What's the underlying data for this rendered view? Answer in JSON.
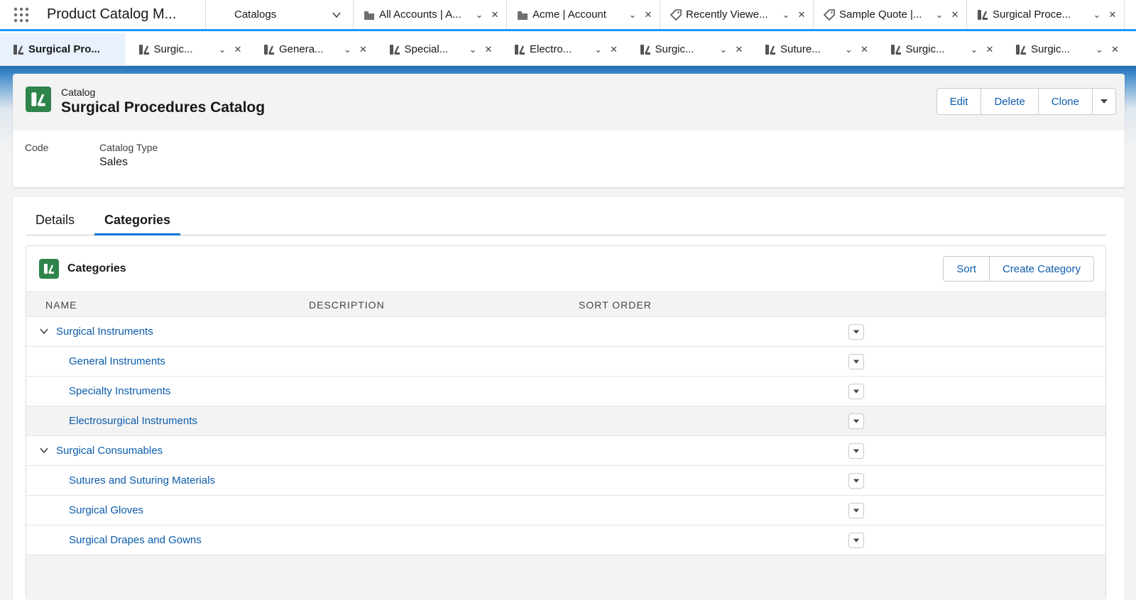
{
  "app": {
    "launcher_icon": "app-launcher-grid-icon",
    "title": "Product Catalog M...",
    "nav_selector": "Catalogs"
  },
  "workspace_tabs": [
    {
      "label": "All Accounts | A...",
      "icon": "account-icon"
    },
    {
      "label": "Acme | Account",
      "icon": "account-icon"
    },
    {
      "label": "Recently Viewe...",
      "icon": "quote-icon"
    },
    {
      "label": "Sample Quote |...",
      "icon": "quote-icon"
    },
    {
      "label": "Surgical Proce...",
      "icon": "catalog-icon",
      "active": true
    }
  ],
  "sub_tabs": [
    {
      "label": "Surgical Pro...",
      "active": true
    },
    {
      "label": "Surgic..."
    },
    {
      "label": "Genera..."
    },
    {
      "label": "Special..."
    },
    {
      "label": "Electro..."
    },
    {
      "label": "Surgic..."
    },
    {
      "label": "Suture..."
    },
    {
      "label": "Surgic..."
    },
    {
      "label": "Surgic..."
    }
  ],
  "record": {
    "object_label": "Catalog",
    "name": "Surgical Procedures Catalog",
    "actions": {
      "edit": "Edit",
      "delete": "Delete",
      "clone": "Clone"
    },
    "fields": {
      "code_label": "Code",
      "catalog_type_label": "Catalog Type",
      "catalog_type_value": "Sales"
    }
  },
  "tabs": {
    "details": "Details",
    "categories": "Categories"
  },
  "related_list": {
    "title": "Categories",
    "sort_label": "Sort",
    "create_label": "Create Category",
    "columns": [
      "NAME",
      "DESCRIPTION",
      "SORT ORDER"
    ],
    "rows": [
      {
        "name": "Surgical Instruments",
        "level": 1,
        "expanded": true
      },
      {
        "name": "General Instruments",
        "level": 2
      },
      {
        "name": "Specialty Instruments",
        "level": 2
      },
      {
        "name": "Electrosurgical Instruments",
        "level": 2,
        "hover": true
      },
      {
        "name": "Surgical Consumables",
        "level": 1,
        "expanded": true
      },
      {
        "name": "Sutures and Suturing Materials",
        "level": 2
      },
      {
        "name": "Surgical Gloves",
        "level": 2
      },
      {
        "name": "Surgical Drapes and Gowns",
        "level": 2
      }
    ]
  },
  "colors": {
    "brand_blue": "#0176d3",
    "link": "#0b5cab",
    "catalog_green": "#2e844a"
  }
}
